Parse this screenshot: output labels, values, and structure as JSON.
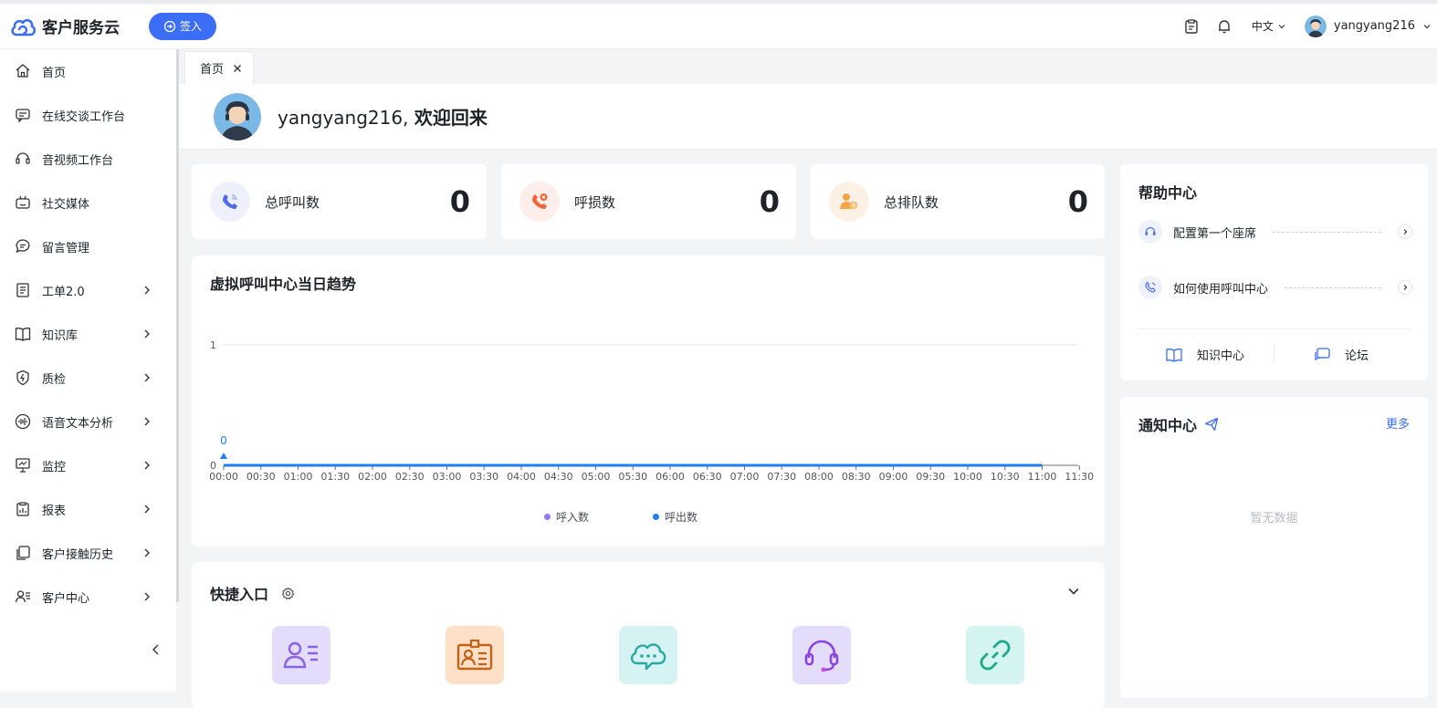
{
  "app": {
    "title": "客户服务云",
    "signin_label": "签入"
  },
  "topbar": {
    "language": "中文",
    "username": "yangyang216"
  },
  "sidebar": {
    "items": [
      {
        "label": "首页",
        "icon": "home-icon",
        "expandable": false
      },
      {
        "label": "在线交谈工作台",
        "icon": "chat-icon",
        "expandable": false
      },
      {
        "label": "音视频工作台",
        "icon": "headset-icon",
        "expandable": false
      },
      {
        "label": "社交媒体",
        "icon": "robot-icon",
        "expandable": false
      },
      {
        "label": "留言管理",
        "icon": "message-icon",
        "expandable": false
      },
      {
        "label": "工单2.0",
        "icon": "document-icon",
        "expandable": true
      },
      {
        "label": "知识库",
        "icon": "book-icon",
        "expandable": true
      },
      {
        "label": "质检",
        "icon": "shield-icon",
        "expandable": true
      },
      {
        "label": "语音文本分析",
        "icon": "waveform-icon",
        "expandable": true
      },
      {
        "label": "监控",
        "icon": "monitor-icon",
        "expandable": true
      },
      {
        "label": "报表",
        "icon": "report-icon",
        "expandable": true
      },
      {
        "label": "客户接触历史",
        "icon": "copy-icon",
        "expandable": true
      },
      {
        "label": "客户中心",
        "icon": "user-list-icon",
        "expandable": true
      }
    ]
  },
  "tabs": [
    {
      "label": "首页"
    }
  ],
  "welcome": {
    "username": "yangyang216, ",
    "greeting": "欢迎回来"
  },
  "stats": [
    {
      "label": "总呼叫数",
      "value": "0",
      "icon": "phone-call-icon",
      "bg": "#eef1fb",
      "color": "#4f6bed"
    },
    {
      "label": "呼损数",
      "value": "0",
      "icon": "phone-missed-icon",
      "bg": "#fdeeec",
      "color": "#f0663c"
    },
    {
      "label": "总排队数",
      "value": "0",
      "icon": "queue-user-icon",
      "bg": "#fdf1e6",
      "color": "#f5a446"
    }
  ],
  "trend": {
    "title": "虚拟呼叫中心当日趋势",
    "legend": [
      {
        "label": "呼入数",
        "color": "#8f7cf5"
      },
      {
        "label": "呼出数",
        "color": "#1f7ef5"
      }
    ]
  },
  "chart_data": {
    "type": "line",
    "title": "虚拟呼叫中心当日趋势",
    "x": [
      "00:00",
      "00:30",
      "01:00",
      "01:30",
      "02:00",
      "02:30",
      "03:00",
      "03:30",
      "04:00",
      "04:30",
      "05:00",
      "05:30",
      "06:00",
      "06:30",
      "07:00",
      "07:30",
      "08:00",
      "08:30",
      "09:00",
      "09:30",
      "10:00",
      "10:30",
      "11:00",
      "11:30"
    ],
    "series": [
      {
        "name": "呼入数",
        "color": "#8f7cf5",
        "values": [
          0,
          0,
          0,
          0,
          0,
          0,
          0,
          0,
          0,
          0,
          0,
          0,
          0,
          0,
          0,
          0,
          0,
          0,
          0,
          0,
          0,
          0,
          0
        ]
      },
      {
        "name": "呼出数",
        "color": "#1f7ef5",
        "values": [
          0,
          0,
          0,
          0,
          0,
          0,
          0,
          0,
          0,
          0,
          0,
          0,
          0,
          0,
          0,
          0,
          0,
          0,
          0,
          0,
          0,
          0,
          0
        ]
      }
    ],
    "ylim": [
      0,
      1
    ],
    "yticks": [
      "0",
      "1"
    ],
    "annotation": "0"
  },
  "help": {
    "title": "帮助中心",
    "items": [
      {
        "label": "配置第一个座席",
        "icon": "headset-icon"
      },
      {
        "label": "如何使用呼叫中心",
        "icon": "phone-call-icon"
      }
    ],
    "links": [
      {
        "label": "知识中心",
        "icon": "book-icon"
      },
      {
        "label": "论坛",
        "icon": "forum-icon"
      }
    ]
  },
  "notice": {
    "title": "通知中心",
    "more": "更多",
    "empty": "暂无数据"
  },
  "quick": {
    "title": "快捷入口",
    "items": [
      {
        "icon": "contact-list-icon",
        "bg": "#e3dcfb",
        "color": "#8a62e6"
      },
      {
        "icon": "id-card-icon",
        "bg": "#fde0c6",
        "color": "#c4621a"
      },
      {
        "icon": "cloud-chat-icon",
        "bg": "#d5f3f3",
        "color": "#2aa8a0"
      },
      {
        "icon": "headset-icon",
        "bg": "#e3dcfb",
        "color": "#8a42e0"
      },
      {
        "icon": "link-icon",
        "bg": "#d3f4f0",
        "color": "#1fa88a"
      }
    ]
  }
}
